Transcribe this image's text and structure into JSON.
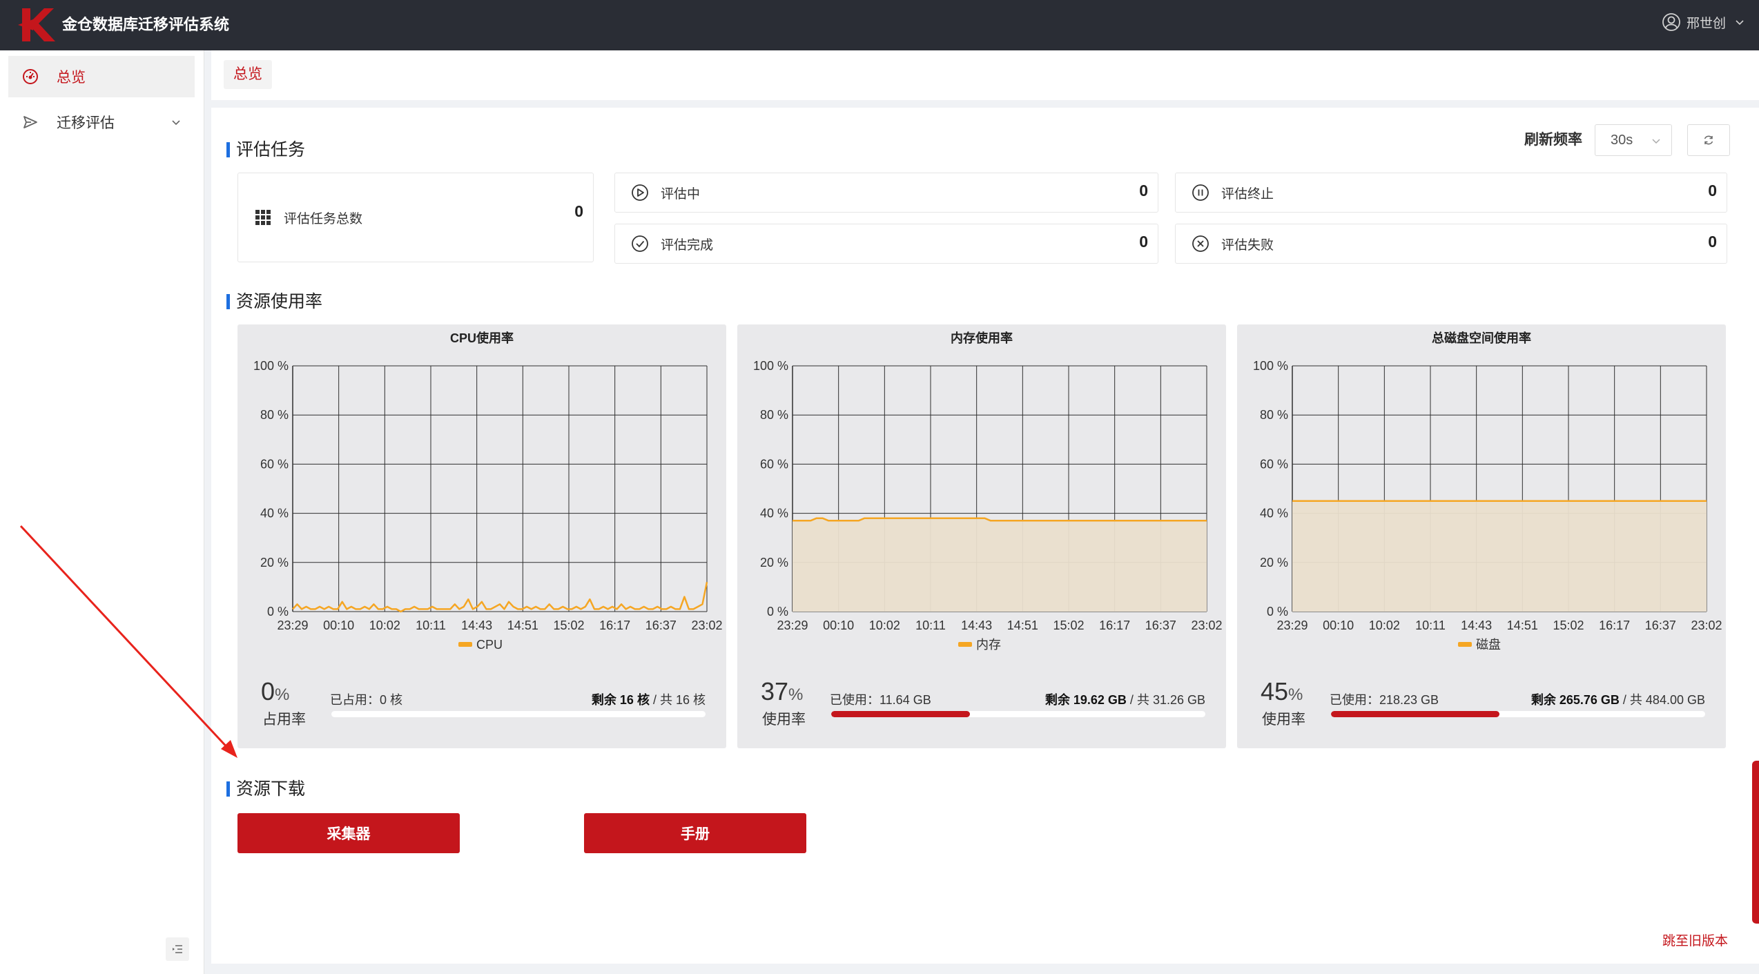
{
  "header": {
    "title": "金仓数据库迁移评估系统",
    "user": "邢世创"
  },
  "sidebar": {
    "items": [
      {
        "label": "总览",
        "icon": "dashboard-icon",
        "active": true
      },
      {
        "label": "迁移评估",
        "icon": "send-icon",
        "active": false
      }
    ]
  },
  "tabs": [
    {
      "label": "总览"
    }
  ],
  "tasks": {
    "title": "评估任务",
    "refresh_label": "刷新频率",
    "refresh_value": "30s",
    "total": {
      "label": "评估任务总数",
      "value": "0"
    },
    "running": {
      "label": "评估中",
      "value": "0"
    },
    "stopped": {
      "label": "评估终止",
      "value": "0"
    },
    "completed": {
      "label": "评估完成",
      "value": "0"
    },
    "failed": {
      "label": "评估失败",
      "value": "0"
    }
  },
  "resources": {
    "title": "资源使用率",
    "cpu": {
      "percent": "0",
      "percent_unit": "%",
      "percent_label": "占用率",
      "used": "已占用：0 核",
      "remain": "剩余 16 核",
      "total": "共 16 核",
      "fill": 0
    },
    "memory": {
      "percent": "37",
      "percent_unit": "%",
      "percent_label": "使用率",
      "used": "已使用：11.64 GB",
      "remain": "剩余 19.62 GB",
      "total": "共 31.26 GB",
      "fill": 0.37
    },
    "disk": {
      "percent": "45",
      "percent_unit": "%",
      "percent_label": "使用率",
      "used": "已使用：218.23 GB",
      "remain": "剩余 265.76 GB",
      "total": "共 484.00 GB",
      "fill": 0.45
    }
  },
  "downloads": {
    "title": "资源下载",
    "collector_label": "采集器",
    "manual_label": "手册"
  },
  "old_version_link": "跳至旧版本",
  "colors": {
    "accent": "#c4161c",
    "header_bg": "#2a2d35",
    "series": "#f5a623",
    "section_bar": "#1d6fe0"
  },
  "chart_data": [
    {
      "type": "line",
      "title": "CPU使用率",
      "x": [
        "23:29",
        "00:10",
        "10:02",
        "10:11",
        "14:43",
        "14:51",
        "15:02",
        "16:17",
        "16:37",
        "23:02"
      ],
      "ylim": [
        0,
        100
      ],
      "yticks": [
        "0 %",
        "20 %",
        "40 %",
        "60 %",
        "80 %",
        "100 %"
      ],
      "grid": true,
      "legend_position": "bottom",
      "series": [
        {
          "name": "CPU",
          "area": false,
          "values": [
            1,
            3,
            1,
            2,
            1,
            1,
            2,
            1,
            2,
            1,
            1,
            4,
            1,
            2,
            1,
            1,
            2,
            1,
            3,
            1,
            1,
            2,
            1,
            1,
            0,
            1,
            1,
            2,
            1,
            1,
            1,
            2,
            1,
            1,
            1,
            1,
            3,
            1,
            2,
            5,
            1,
            2,
            4,
            1,
            1,
            2,
            3,
            1,
            4,
            2,
            1,
            1,
            2,
            1,
            2,
            1,
            1,
            3,
            1,
            1,
            2,
            1,
            1,
            2,
            1,
            2,
            5,
            1,
            1,
            2,
            1,
            2,
            1,
            3,
            1,
            2,
            1,
            1,
            2,
            1,
            1,
            2,
            1,
            1,
            2,
            1,
            1,
            6,
            1,
            1,
            2,
            3,
            12
          ]
        }
      ]
    },
    {
      "type": "area",
      "title": "内存使用率",
      "x": [
        "23:29",
        "00:10",
        "10:02",
        "10:11",
        "14:43",
        "14:51",
        "15:02",
        "16:17",
        "16:37",
        "23:02"
      ],
      "ylim": [
        0,
        100
      ],
      "yticks": [
        "0 %",
        "20 %",
        "40 %",
        "60 %",
        "80 %",
        "100 %"
      ],
      "grid": true,
      "legend_position": "bottom",
      "series": [
        {
          "name": "内存",
          "area": true,
          "values": [
            37,
            37,
            37,
            37,
            38,
            38,
            37,
            37,
            37,
            37,
            37,
            37,
            38,
            38,
            38,
            38,
            38,
            38,
            38,
            38,
            38,
            38,
            38,
            38,
            38,
            38,
            38,
            38,
            38,
            38,
            38,
            38,
            38,
            37,
            37,
            37,
            37,
            37,
            37,
            37,
            37,
            37,
            37,
            37,
            37,
            37,
            37,
            37,
            37,
            37,
            37,
            37,
            37,
            37,
            37,
            37,
            37,
            37,
            37,
            37,
            37,
            37,
            37,
            37,
            37,
            37,
            37,
            37,
            37,
            37
          ]
        }
      ]
    },
    {
      "type": "area",
      "title": "总磁盘空间使用率",
      "x": [
        "23:29",
        "00:10",
        "10:02",
        "10:11",
        "14:43",
        "14:51",
        "15:02",
        "16:17",
        "16:37",
        "23:02"
      ],
      "ylim": [
        0,
        100
      ],
      "yticks": [
        "0 %",
        "20 %",
        "40 %",
        "60 %",
        "80 %",
        "100 %"
      ],
      "grid": true,
      "legend_position": "bottom",
      "series": [
        {
          "name": "磁盘",
          "area": true,
          "values": [
            45,
            45,
            45,
            45,
            45,
            45,
            45,
            45,
            45,
            45,
            45,
            45,
            45,
            45,
            45,
            45,
            45,
            45,
            45,
            45
          ]
        }
      ]
    }
  ]
}
